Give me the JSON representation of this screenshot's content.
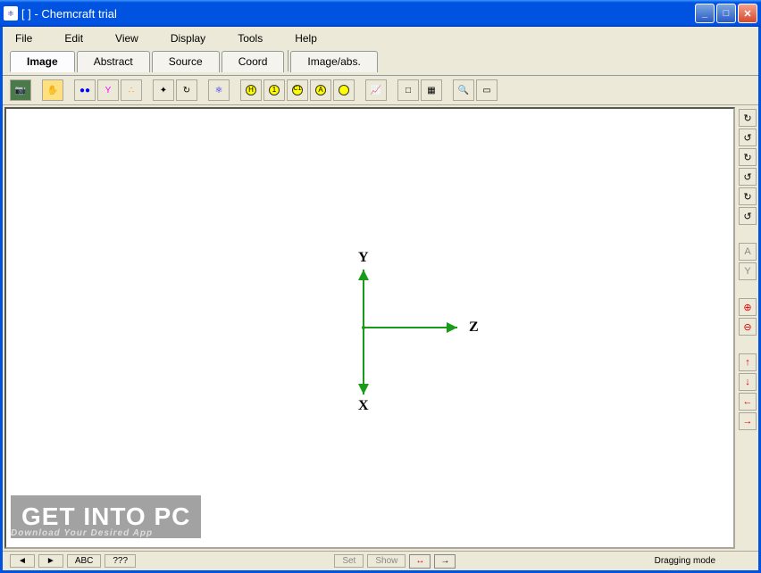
{
  "window": {
    "title": "[ ] - Chemcraft trial"
  },
  "menubar": {
    "items": [
      "File",
      "Edit",
      "View",
      "Display",
      "Tools",
      "Help"
    ]
  },
  "tabs": {
    "items": [
      "Image",
      "Abstract",
      "Source",
      "Coord",
      "Image/abs."
    ],
    "active": 0
  },
  "toolbar": {
    "groups": [
      {
        "icons": [
          "camera-icon",
          "highlight-icon"
        ]
      },
      {
        "icons": [
          "bond-blue-icon",
          "bond-colored-icon",
          "bond-dots-icon"
        ]
      },
      {
        "icons": [
          "sparkle-icon",
          "refresh-icon"
        ]
      },
      {
        "icons": [
          "atom-orbit-icon"
        ]
      },
      {
        "icons": [
          "h-yellow-icon",
          "one-yellow-icon",
          "c1-yellow-icon",
          "a-yellow-icon",
          "yellow-circle-icon"
        ]
      },
      {
        "icons": [
          "graph-icon"
        ]
      },
      {
        "icons": [
          "square-icon",
          "grid-icon"
        ]
      },
      {
        "icons": [
          "magnify-icon",
          "camera2-icon"
        ]
      }
    ]
  },
  "side_toolbar": {
    "items": [
      "rotate-cw-icon",
      "rotate-ccw-icon",
      "rotate-cw2-icon",
      "rotate-ccw2-icon",
      "rotate-cw3-icon",
      "rotate-ccw3-icon",
      "sep",
      "letter-a-icon",
      "flip-y-icon",
      "sep",
      "zoom-in-icon",
      "zoom-out-icon",
      "sep",
      "arrow-up-red-icon",
      "arrow-down-red-icon",
      "arrow-left-red-icon",
      "arrow-right-red-icon"
    ]
  },
  "canvas": {
    "axes": {
      "y": "Y",
      "z": "Z",
      "x": "X"
    }
  },
  "watermark": {
    "text": "GET INTO PC",
    "subtitle": "Download Your Desired App"
  },
  "statusbar": {
    "left_btns": [
      "ABC",
      "???"
    ],
    "set_btn": "Set",
    "show_btn": "Show",
    "mode_text": "Dragging mode"
  }
}
